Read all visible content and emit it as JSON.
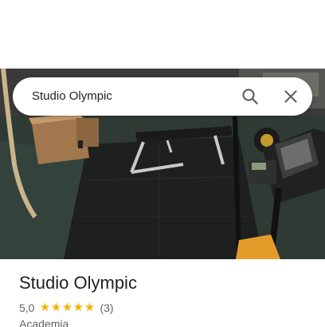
{
  "search": {
    "query": "Studio Olympic"
  },
  "place": {
    "name": "Studio Olympic",
    "rating": "5,0",
    "stars": 5,
    "review_count": "(3)",
    "category": "Academia"
  },
  "icons": {
    "search": "search-icon",
    "close": "close-icon",
    "star": "star-icon"
  },
  "colors": {
    "star": "#f4b400",
    "text_primary": "#202124",
    "text_secondary": "#5f6368"
  }
}
